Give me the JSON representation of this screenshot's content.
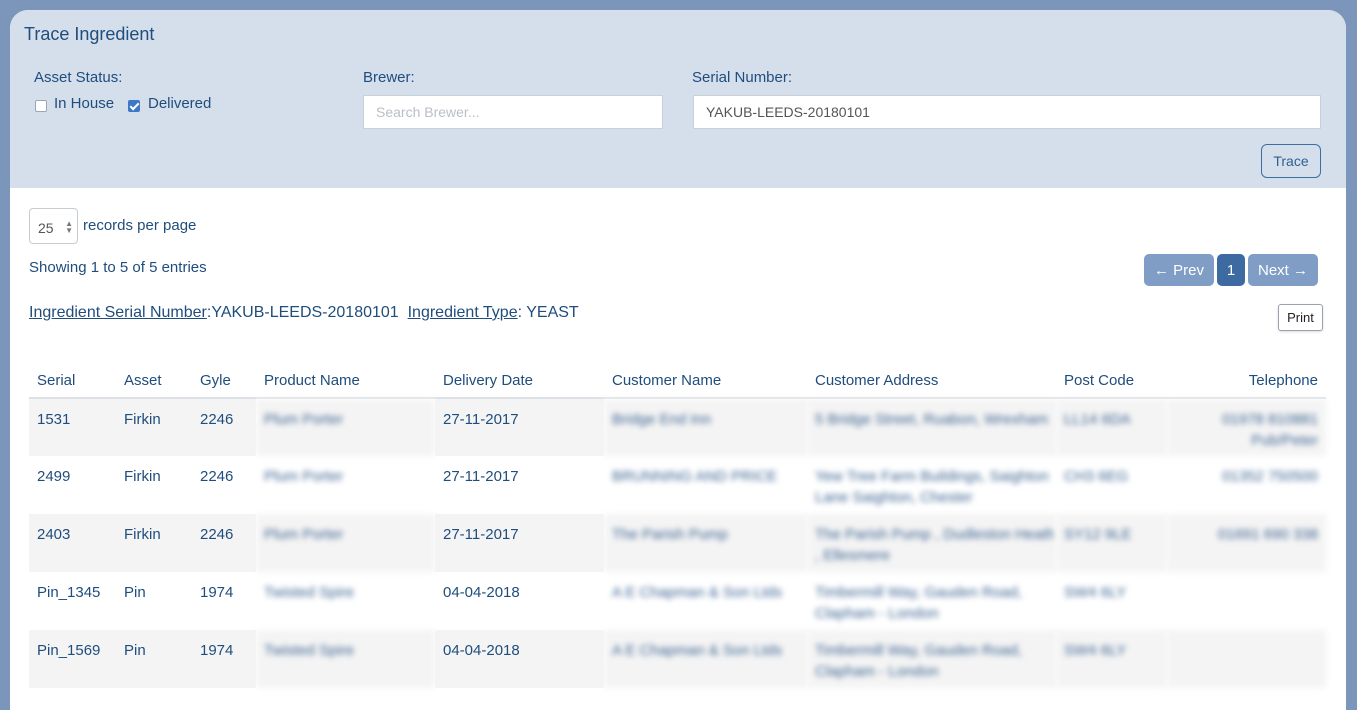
{
  "title": "Trace Ingredient",
  "filters": {
    "asset_status_label": "Asset Status:",
    "in_house_label": "In House",
    "in_house_checked": false,
    "delivered_label": "Delivered",
    "delivered_checked": true,
    "brewer_label": "Brewer:",
    "brewer_placeholder": "Search Brewer...",
    "brewer_value": "",
    "serial_label": "Serial Number:",
    "serial_value": "YAKUB-LEEDS-20180101",
    "trace_label": "Trace"
  },
  "listing": {
    "per_page_value": "25",
    "per_page_label": "records per page",
    "showing_text": "Showing 1 to 5 of 5 entries",
    "prev_label": "← Prev",
    "current_page": "1",
    "next_label": "Next →"
  },
  "ingredient": {
    "serial_key": "Ingredient Serial Number",
    "serial_value": "YAKUB-LEEDS-20180101",
    "type_key": "Ingredient Type",
    "type_value": "YEAST"
  },
  "print_label": "Print",
  "table": {
    "columns": [
      "Serial",
      "Asset",
      "Gyle",
      "Product Name",
      "Delivery Date",
      "Customer Name",
      "Customer Address",
      "Post Code",
      "Telephone"
    ],
    "rows": [
      [
        "1531",
        "Firkin",
        "2246",
        "Plum Porter",
        "27-11-2017",
        "Bridge End Inn",
        "5 Bridge Street, Ruabon, Wrexham",
        "LL14 6DA",
        "01978 810881 Pub/Peter"
      ],
      [
        "2499",
        "Firkin",
        "2246",
        "Plum Porter",
        "27-11-2017",
        "BRUNNING AND PRICE",
        "Yew Tree Farm Buildings, Saighton Lane Saighton, Chester",
        "CH3 6EG",
        "01352 750500"
      ],
      [
        "2403",
        "Firkin",
        "2246",
        "Plum Porter",
        "27-11-2017",
        "The Parish Pump",
        "The Parish Pump , Dudleston Heath , Ellesmere",
        "SY12 9LE",
        "01691 690 338"
      ],
      [
        "Pin_1345",
        "Pin",
        "1974",
        "Twisted Spire",
        "04-04-2018",
        "A E Chapman & Son Ltds",
        "Timbermill Way, Gauden Road, Clapham - London",
        "SW4 6LY",
        ""
      ],
      [
        "Pin_1569",
        "Pin",
        "1974",
        "Twisted Spire",
        "04-04-2018",
        "A E Chapman & Son Ltds",
        "Timbermill Way, Gauden Road, Clapham - London",
        "SW4 6LY",
        ""
      ]
    ]
  }
}
